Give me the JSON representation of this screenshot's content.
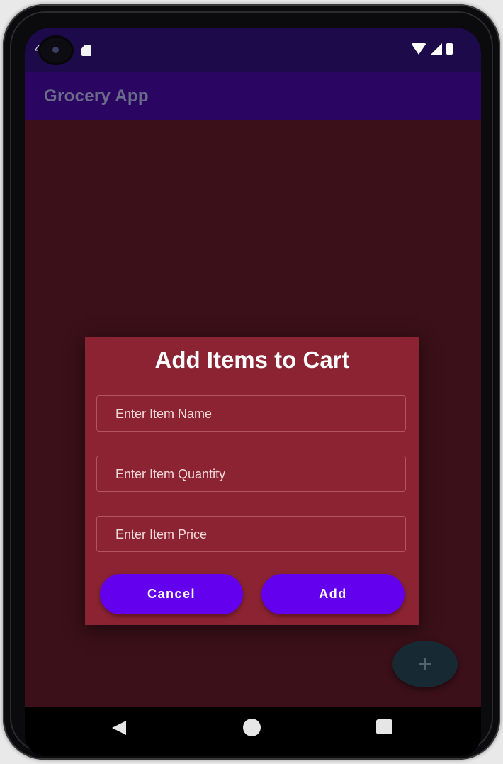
{
  "status_bar": {
    "time": "4"
  },
  "app_bar": {
    "title": "Grocery App"
  },
  "dialog": {
    "title": "Add Items to Cart",
    "fields": [
      {
        "placeholder": "Enter Item Name"
      },
      {
        "placeholder": "Enter Item Quantity"
      },
      {
        "placeholder": "Enter Item Price"
      }
    ],
    "cancel_label": "Cancel",
    "add_label": "Add"
  },
  "fab": {
    "label": "+"
  },
  "colors": {
    "app_bar": "#2a0562",
    "dialog_bg": "#8b2332",
    "button_bg": "#6300ee",
    "content_bg": "#3b1018"
  },
  "icons": [
    "camera-icon",
    "sd-card-icon",
    "wifi-icon",
    "signal-icon",
    "battery-icon",
    "plus-icon",
    "back-icon",
    "home-icon",
    "recents-icon"
  ]
}
